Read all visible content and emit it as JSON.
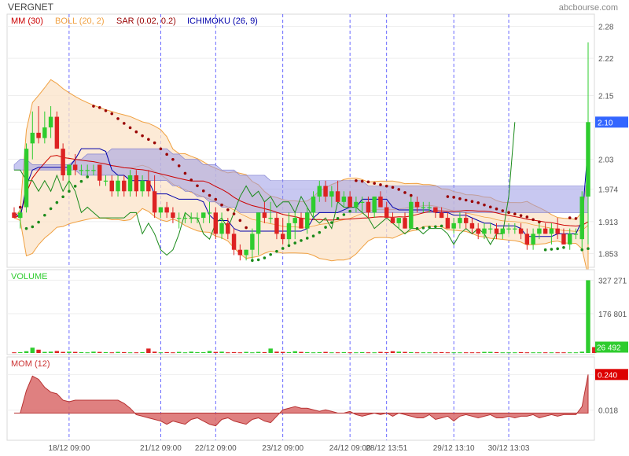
{
  "header": {
    "symbol": "VERGNET",
    "brand": "abcbourse.com"
  },
  "legend": [
    {
      "label": "MM (30)",
      "color": "#cc0000"
    },
    {
      "label": "BOLL (20, 2)",
      "color": "#f0a040"
    },
    {
      "label": "SAR (0.02, 0.2)",
      "color": "#990000"
    },
    {
      "label": "ICHIMOKU (26, 9)",
      "color": "#0000aa"
    }
  ],
  "colors": {
    "up": "#2ecc2e",
    "down": "#dd2222",
    "boll": "#f0a040",
    "mm": "#cc0000",
    "sar": "#990000",
    "ichimoku": "#0000aa",
    "chikou": "#1a8a1a",
    "mom": "#cc3333",
    "last_value_bg": "#3366ff",
    "last_value_red": "#dd0000"
  },
  "chart_data": [
    {
      "type": "candlestick",
      "title": "VERGNET",
      "y_ticks": [
        "2.28",
        "2.22",
        "2.15",
        "2.10",
        "2.03",
        "1.974",
        "1.913",
        "1.853"
      ],
      "ylim": [
        1.83,
        2.3
      ],
      "last_value": "2.10",
      "x_ticks": [
        "18/12 09:00",
        "21/12 09:00",
        "22/12 09:00",
        "23/12 09:00",
        "24/12 09:00",
        "28/12 13:51",
        "29/12 13:10",
        "30/12 13:03"
      ],
      "session_breaks_index": [
        9,
        24,
        33,
        44,
        55,
        61,
        72,
        81
      ],
      "candles": [
        [
          1.93,
          1.94,
          1.92,
          1.92
        ],
        [
          1.92,
          1.94,
          1.9,
          1.93
        ],
        [
          1.94,
          2.06,
          1.93,
          2.05
        ],
        [
          2.06,
          2.12,
          2.03,
          2.08
        ],
        [
          2.08,
          2.13,
          2.06,
          2.07
        ],
        [
          2.07,
          2.12,
          2.06,
          2.09
        ],
        [
          2.09,
          2.13,
          2.07,
          2.11
        ],
        [
          2.11,
          2.12,
          2.05,
          2.05
        ],
        [
          2.05,
          2.06,
          1.99,
          2.0
        ],
        [
          2.0,
          2.02,
          1.97,
          2.02
        ],
        [
          2.02,
          2.04,
          2.0,
          2.01
        ],
        [
          2.01,
          2.02,
          2.0,
          2.01
        ],
        [
          2.01,
          2.02,
          2.0,
          2.01
        ],
        [
          2.01,
          2.02,
          2.0,
          2.01
        ],
        [
          2.02,
          2.02,
          1.98,
          1.99
        ],
        [
          1.99,
          2.0,
          1.98,
          1.99
        ],
        [
          1.99,
          2.0,
          1.96,
          1.97
        ],
        [
          1.97,
          2.0,
          1.96,
          1.99
        ],
        [
          1.99,
          2.0,
          1.96,
          1.97
        ],
        [
          1.97,
          2.01,
          1.96,
          2.0
        ],
        [
          2.0,
          2.01,
          1.96,
          1.97
        ],
        [
          1.97,
          2.0,
          1.96,
          1.99
        ],
        [
          1.99,
          2.01,
          1.96,
          1.97
        ],
        [
          1.97,
          2.0,
          1.92,
          1.93
        ],
        [
          1.93,
          1.94,
          1.92,
          1.94
        ],
        [
          1.94,
          1.95,
          1.92,
          1.93
        ],
        [
          1.93,
          1.94,
          1.91,
          1.92
        ],
        [
          1.92,
          1.93,
          1.9,
          1.92
        ],
        [
          1.92,
          1.93,
          1.91,
          1.92
        ],
        [
          1.92,
          1.93,
          1.91,
          1.92
        ],
        [
          1.92,
          1.93,
          1.91,
          1.92
        ],
        [
          1.92,
          1.93,
          1.91,
          1.93
        ],
        [
          1.93,
          1.95,
          1.91,
          1.93
        ],
        [
          1.93,
          1.94,
          1.88,
          1.89
        ],
        [
          1.89,
          1.93,
          1.88,
          1.91
        ],
        [
          1.91,
          1.92,
          1.88,
          1.89
        ],
        [
          1.89,
          1.9,
          1.85,
          1.86
        ],
        [
          1.86,
          1.87,
          1.84,
          1.85
        ],
        [
          1.85,
          1.86,
          1.84,
          1.86
        ],
        [
          1.86,
          1.9,
          1.84,
          1.89
        ],
        [
          1.89,
          1.93,
          1.85,
          1.93
        ],
        [
          1.93,
          1.95,
          1.91,
          1.92
        ],
        [
          1.92,
          1.95,
          1.91,
          1.92
        ],
        [
          1.92,
          1.93,
          1.88,
          1.89
        ],
        [
          1.89,
          1.92,
          1.87,
          1.88
        ],
        [
          1.88,
          1.93,
          1.87,
          1.91
        ],
        [
          1.91,
          1.93,
          1.88,
          1.92
        ],
        [
          1.92,
          1.93,
          1.9,
          1.9
        ],
        [
          1.9,
          1.94,
          1.89,
          1.93
        ],
        [
          1.93,
          1.97,
          1.92,
          1.96
        ],
        [
          1.96,
          1.99,
          1.95,
          1.98
        ],
        [
          1.98,
          1.99,
          1.95,
          1.96
        ],
        [
          1.96,
          1.98,
          1.94,
          1.97
        ],
        [
          1.97,
          1.99,
          1.95,
          1.95
        ],
        [
          1.95,
          1.97,
          1.94,
          1.96
        ],
        [
          1.96,
          1.97,
          1.94,
          1.94
        ],
        [
          1.94,
          1.96,
          1.93,
          1.95
        ],
        [
          1.95,
          1.96,
          1.93,
          1.95
        ],
        [
          1.95,
          1.96,
          1.92,
          1.93
        ],
        [
          1.93,
          1.96,
          1.92,
          1.96
        ],
        [
          1.96,
          1.97,
          1.94,
          1.94
        ],
        [
          1.94,
          1.95,
          1.92,
          1.92
        ],
        [
          1.92,
          1.93,
          1.91,
          1.91
        ],
        [
          1.91,
          1.92,
          1.9,
          1.92
        ],
        [
          1.92,
          1.93,
          1.9,
          1.9
        ],
        [
          1.9,
          1.96,
          1.9,
          1.95
        ],
        [
          1.95,
          1.96,
          1.93,
          1.94
        ],
        [
          1.94,
          1.95,
          1.93,
          1.94
        ],
        [
          1.94,
          1.95,
          1.93,
          1.94
        ],
        [
          1.94,
          1.94,
          1.92,
          1.93
        ],
        [
          1.93,
          1.94,
          1.92,
          1.92
        ],
        [
          1.92,
          1.93,
          1.9,
          1.9
        ],
        [
          1.9,
          1.92,
          1.89,
          1.91
        ],
        [
          1.91,
          1.93,
          1.9,
          1.92
        ],
        [
          1.92,
          1.93,
          1.9,
          1.91
        ],
        [
          1.91,
          1.92,
          1.89,
          1.9
        ],
        [
          1.9,
          1.91,
          1.88,
          1.89
        ],
        [
          1.89,
          1.91,
          1.88,
          1.9
        ],
        [
          1.9,
          1.91,
          1.89,
          1.9
        ],
        [
          1.9,
          1.91,
          1.88,
          1.89
        ],
        [
          1.89,
          1.9,
          1.88,
          1.9
        ],
        [
          1.9,
          1.91,
          1.89,
          1.9
        ],
        [
          1.9,
          1.91,
          1.89,
          1.9
        ],
        [
          1.9,
          1.91,
          1.88,
          1.89
        ],
        [
          1.89,
          1.9,
          1.86,
          1.87
        ],
        [
          1.87,
          1.9,
          1.86,
          1.89
        ],
        [
          1.89,
          1.91,
          1.88,
          1.9
        ],
        [
          1.9,
          1.91,
          1.89,
          1.89
        ],
        [
          1.89,
          1.91,
          1.87,
          1.9
        ],
        [
          1.9,
          1.92,
          1.88,
          1.89
        ],
        [
          1.89,
          1.9,
          1.87,
          1.87
        ],
        [
          1.87,
          1.9,
          1.86,
          1.89
        ],
        [
          1.89,
          1.9,
          1.88,
          1.89
        ],
        [
          1.88,
          1.97,
          1.86,
          1.96
        ],
        [
          1.96,
          2.25,
          1.87,
          2.1
        ]
      ],
      "cloud_upper": [
        2.02,
        2.03,
        2.03,
        2.02,
        2.02,
        2.02,
        2.02,
        2.02,
        2.02,
        2.02,
        2.03,
        2.03,
        2.04,
        2.04,
        2.04,
        2.04,
        2.05,
        2.05,
        2.05,
        2.05,
        2.05,
        2.05,
        2.05,
        2.05,
        2.05,
        2.05,
        2.04,
        2.04,
        2.03,
        2.03,
        2.03,
        2.02,
        2.02,
        2.02,
        2.01,
        2.01,
        2.01,
        2.0,
        2.0,
        2.0,
        2.0,
        2.0,
        1.99,
        1.99,
        1.99,
        1.99,
        1.99,
        1.99,
        1.99,
        1.99,
        1.99,
        1.99,
        1.99,
        1.99,
        1.99,
        1.99,
        1.99,
        1.99,
        1.98,
        1.98,
        1.98,
        1.98,
        1.98,
        1.98,
        1.98,
        1.98,
        1.98,
        1.98,
        1.98,
        1.98,
        1.98,
        1.98,
        1.98,
        1.98,
        1.98,
        1.98,
        1.98,
        1.98,
        1.98,
        1.98,
        1.98,
        1.98,
        1.98,
        1.98,
        1.98,
        1.98,
        1.98,
        1.98,
        1.98,
        1.98,
        1.98,
        1.98,
        1.98,
        1.98,
        1.98
      ],
      "cloud_lower": [
        2.01,
        2.01,
        2.01,
        2.01,
        2.01,
        2.01,
        2.01,
        2.01,
        2.01,
        2.01,
        2.01,
        2.0,
        2.0,
        2.0,
        2.0,
        2.0,
        2.0,
        2.0,
        2.0,
        1.99,
        1.99,
        1.99,
        1.99,
        1.99,
        1.99,
        1.99,
        1.98,
        1.98,
        1.97,
        1.97,
        1.96,
        1.96,
        1.95,
        1.95,
        1.94,
        1.94,
        1.94,
        1.93,
        1.93,
        1.93,
        1.93,
        1.93,
        1.93,
        1.93,
        1.93,
        1.93,
        1.93,
        1.93,
        1.93,
        1.93,
        1.93,
        1.93,
        1.93,
        1.93,
        1.93,
        1.93,
        1.93,
        1.93,
        1.93,
        1.93,
        1.93,
        1.93,
        1.93,
        1.93,
        1.93,
        1.93,
        1.93,
        1.93,
        1.93,
        1.93,
        1.93,
        1.93,
        1.93,
        1.93,
        1.93,
        1.93,
        1.93,
        1.93,
        1.93,
        1.93,
        1.93,
        1.93,
        1.93,
        1.93,
        1.93,
        1.93,
        1.93,
        1.93,
        1.93,
        1.93,
        1.93,
        1.93,
        1.93,
        1.93,
        1.93
      ]
    },
    {
      "type": "bar",
      "title": "VOLUME",
      "y_ticks": [
        "327 271",
        "176 801"
      ],
      "ylim": [
        0,
        350000
      ],
      "last_value": "26 492",
      "values": [
        3000,
        4000,
        8000,
        24000,
        15000,
        5000,
        6000,
        9000,
        5000,
        6000,
        5000,
        4000,
        3000,
        6000,
        5000,
        4000,
        3000,
        5000,
        4000,
        3000,
        3000,
        4000,
        20000,
        6000,
        3000,
        4000,
        3000,
        5000,
        3000,
        6000,
        4000,
        4000,
        9000,
        5000,
        6000,
        3000,
        4000,
        3000,
        5000,
        3000,
        5000,
        4000,
        20000,
        6000,
        5000,
        4000,
        8000,
        5000,
        4000,
        3000,
        4000,
        5000,
        3000,
        3000,
        4000,
        3000,
        3000,
        4000,
        3000,
        3000,
        5000,
        4000,
        8000,
        6000,
        5000,
        4000,
        3000,
        3000,
        3000,
        3000,
        4000,
        3000,
        3000,
        3000,
        3000,
        3000,
        3000,
        5000,
        5000,
        4000,
        3000,
        3000,
        3000,
        4000,
        3000,
        3000,
        3000,
        3000,
        3000,
        3000,
        3000,
        3000,
        3000,
        6000,
        327271,
        26492
      ]
    },
    {
      "type": "area",
      "title": "MOM (12)",
      "y_ticks": [
        "0.240",
        "0.018"
      ],
      "ylim": [
        -0.16,
        0.32
      ],
      "last_value": "0.240",
      "values": [
        0.0,
        0.0,
        0.14,
        0.23,
        0.21,
        0.16,
        0.13,
        0.12,
        0.08,
        0.07,
        0.08,
        0.08,
        0.08,
        0.08,
        0.08,
        0.08,
        0.08,
        0.08,
        0.06,
        0.03,
        -0.01,
        -0.02,
        -0.03,
        -0.04,
        -0.05,
        -0.07,
        -0.05,
        -0.06,
        -0.07,
        -0.04,
        -0.03,
        -0.05,
        -0.07,
        -0.08,
        -0.04,
        -0.03,
        -0.05,
        -0.06,
        -0.07,
        -0.04,
        -0.03,
        -0.05,
        -0.06,
        -0.02,
        0.02,
        0.03,
        0.04,
        0.03,
        0.03,
        0.02,
        0.01,
        0.02,
        0.01,
        0.0,
        0.0,
        0.01,
        -0.01,
        -0.02,
        -0.01,
        0.0,
        -0.01,
        0.0,
        -0.02,
        0.0,
        -0.01,
        -0.02,
        -0.03,
        -0.03,
        -0.01,
        -0.04,
        -0.03,
        -0.02,
        -0.05,
        -0.02,
        -0.01,
        -0.02,
        -0.03,
        -0.02,
        -0.01,
        -0.03,
        -0.03,
        -0.02,
        -0.03,
        -0.02,
        -0.02,
        -0.01,
        -0.03,
        -0.02,
        -0.01,
        -0.02,
        -0.01,
        -0.01,
        -0.01,
        0.04,
        0.24
      ]
    }
  ]
}
